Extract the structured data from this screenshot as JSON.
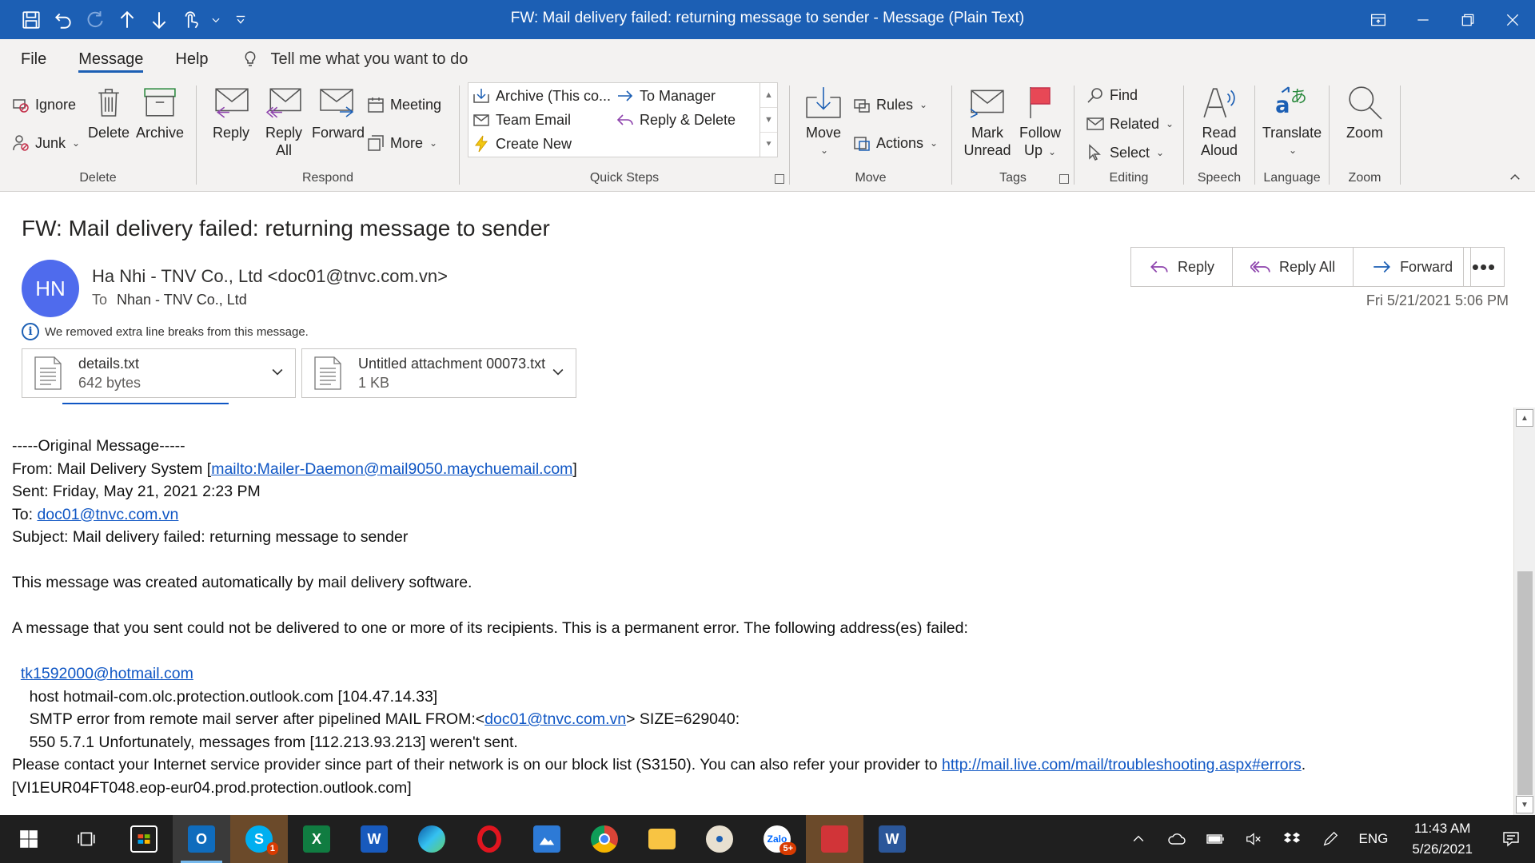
{
  "window": {
    "title": "FW: Mail delivery failed: returning message to sender  -  Message (Plain Text)"
  },
  "tabs": [
    {
      "label": "File"
    },
    {
      "label": "Message",
      "active": true
    },
    {
      "label": "Help"
    }
  ],
  "tellme": {
    "text": "Tell me what you want to do"
  },
  "ribbon": {
    "delete_group": {
      "label": "Delete",
      "ignore": "Ignore",
      "junk": "Junk",
      "delete": "Delete",
      "archive": "Archive"
    },
    "respond_group": {
      "label": "Respond",
      "reply": "Reply",
      "reply_all_1": "Reply",
      "reply_all_2": "All",
      "forward": "Forward",
      "meeting": "Meeting",
      "more": "More"
    },
    "quicksteps_group": {
      "label": "Quick Steps",
      "archive_this": "Archive (This co...",
      "to_manager": "To Manager",
      "team_email": "Team Email",
      "reply_delete": "Reply & Delete",
      "create_new": "Create New"
    },
    "move_group": {
      "label": "Move",
      "move": "Move",
      "rules": "Rules",
      "actions": "Actions"
    },
    "tags_group": {
      "label": "Tags",
      "mark_unread_1": "Mark",
      "mark_unread_2": "Unread",
      "follow_up_1": "Follow",
      "follow_up_2": "Up"
    },
    "editing_group": {
      "label": "Editing",
      "find": "Find",
      "related": "Related",
      "select": "Select"
    },
    "speech_group": {
      "label": "Speech",
      "read_aloud_1": "Read",
      "read_aloud_2": "Aloud"
    },
    "language_group": {
      "label": "Language",
      "translate": "Translate"
    },
    "zoom_group": {
      "label": "Zoom",
      "zoom": "Zoom"
    }
  },
  "message": {
    "subject": "FW: Mail delivery failed: returning message to sender",
    "avatar_initials": "HN",
    "sender": "Ha Nhi - TNV Co., Ltd <doc01@tnvc.com.vn>",
    "to_label": "To",
    "to_name": "Nhan - TNV Co., Ltd",
    "info_notice": "We removed extra line breaks from this message.",
    "date": "Fri 5/21/2021 5:06 PM",
    "actions": {
      "reply": "Reply",
      "reply_all": "Reply All",
      "forward": "Forward",
      "more": "•••"
    },
    "attachments": [
      {
        "name": "details.txt",
        "size": "642 bytes"
      },
      {
        "name": "Untitled attachment 00073.txt",
        "size": "1 KB"
      }
    ]
  },
  "body": {
    "original_header": "-----Original Message-----",
    "from_label": "From: Mail Delivery System [",
    "from_link": "mailto:Mailer-Daemon@mail9050.maychuemail.com",
    "from_end": "]",
    "sent": "Sent: Friday, May 21, 2021 2:23 PM",
    "to_label": "To: ",
    "to_link": "doc01@tnvc.com.vn",
    "subject": "Subject: Mail delivery failed: returning message to sender",
    "auto_msg": "This message was created automatically by mail delivery software.",
    "perm_error": "A message that you sent could not be delivered to one or more of its recipients. This is a permanent error. The following address(es) failed:",
    "failed_addr": "tk1592000@hotmail.com",
    "host_line": "    host hotmail-com.olc.protection.outlook.com [104.47.14.33]",
    "smtp_pre": "    SMTP error from remote mail server after pipelined MAIL FROM:<",
    "smtp_link": "doc01@tnvc.com.vn",
    "smtp_post": "> SIZE=629040:",
    "code_line": "    550 5.7.1 Unfortunately, messages from [112.213.93.213] weren't sent.",
    "contact_pre": "Please contact your Internet service provider since part of their network is on our block list (S3150). You can also refer your provider to ",
    "contact_link": "http://mail.live.com/mail/troubleshooting.aspx#errors",
    "contact_post": ".",
    "server_line": "[VI1EUR04FT048.eop-eur04.prod.protection.outlook.com]"
  },
  "taskbar": {
    "lang": "ENG",
    "time": "11:43 AM",
    "date": "5/26/2021",
    "skype_badge": "1",
    "zalo_badge": "5+"
  },
  "colors": {
    "titlebar": "#1c5fb4",
    "link": "#0f56c4",
    "avatar": "#4f6bed",
    "taskbar": "#1f1f1f"
  }
}
